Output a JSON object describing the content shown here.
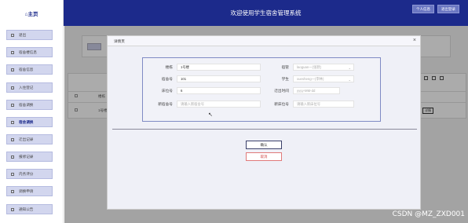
{
  "header": {
    "brand": "⌂主页",
    "title": "欢迎使用学生宿舍管理系统",
    "buttons": [
      "个人信息",
      "退出登录"
    ]
  },
  "sidebar": {
    "items": [
      {
        "label": "退出",
        "icon": "logout-icon"
      },
      {
        "label": "宿舍楼信息",
        "icon": "building-icon"
      },
      {
        "label": "宿舍信息",
        "icon": "room-icon"
      },
      {
        "label": "入住登记",
        "icon": "checkin-icon"
      },
      {
        "label": "宿舍调换",
        "icon": "swap-icon"
      },
      {
        "label": "宿舍调换",
        "icon": "swap-icon"
      },
      {
        "label": "迁出记录",
        "icon": "moveout-icon"
      },
      {
        "label": "报修记录",
        "icon": "repair-icon"
      },
      {
        "label": "内务评分",
        "icon": "score-icon"
      },
      {
        "label": "调换申请",
        "icon": "apply-icon"
      },
      {
        "label": "通知公告",
        "icon": "notice-icon"
      }
    ]
  },
  "background": {
    "row_cells": [
      "楼栋",
      "1号楼"
    ],
    "tag": "详情"
  },
  "modal": {
    "title": "详情页",
    "close": "×",
    "fields": {
      "building_label": "楼栋",
      "building_value": "1号楼",
      "dorm_admin_label": "宿管",
      "dorm_admin_placeholder": "laoguan一(张默)",
      "room_label": "宿舍号",
      "room_value": "101",
      "student_label": "学生",
      "student_placeholder": "xuesheng一(李林)",
      "bed_label": "床位号",
      "bed_value": "6",
      "move_time_label": "迁出时间",
      "move_time_placeholder": "yyyy-MM-dd",
      "new_room_label": "新宿舍号",
      "new_room_placeholder": "请输入新宿舍号",
      "new_bed_label": "新床位号",
      "new_bed_placeholder": "请输入新床位号"
    },
    "ok_label": "确认",
    "cancel_label": "取消"
  },
  "watermark": "CSDN @MZ_ZXD001",
  "colors": {
    "header": "#1c2a8b",
    "sidebar_item": "#d2d6ee",
    "cancel": "#d04b4b"
  }
}
